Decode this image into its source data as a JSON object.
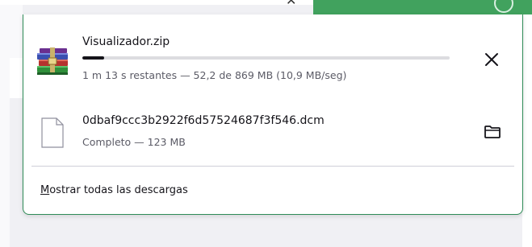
{
  "downloads": [
    {
      "filename": "Visualizador.zip",
      "status": "1 m 13 s restantes — 52,2 de 869 MB (10,9 MB/seg)",
      "progress_fraction": 0.06,
      "icon": "winrar-archive-icon",
      "action": "cancel"
    },
    {
      "filename": "0dbaf9ccc3b2922f6d57524687f3f546.dcm",
      "status": "Completo — 123 MB",
      "icon": "generic-file-icon",
      "action": "show-in-folder"
    }
  ],
  "footer": {
    "show_all_accel": "M",
    "show_all_rest": "ostrar todas las descargas"
  },
  "colors": {
    "accent_green": "#41a25e",
    "panel_border": "#2e8b57",
    "text_primary": "#15141a",
    "text_secondary": "#5b5b66"
  }
}
